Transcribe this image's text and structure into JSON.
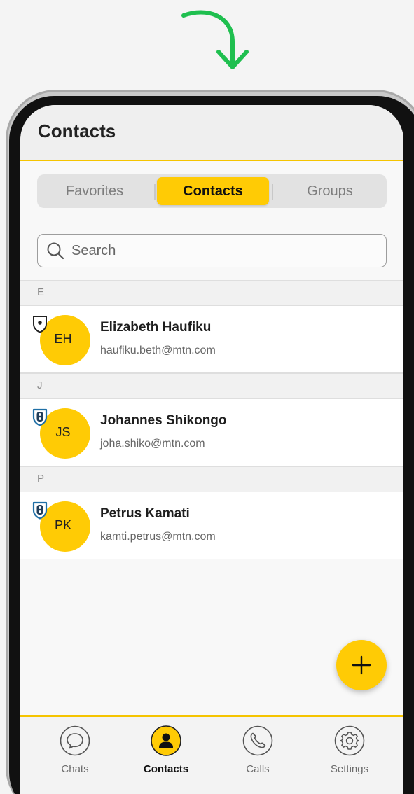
{
  "header": {
    "title": "Contacts"
  },
  "segmented": {
    "favorites": "Favorites",
    "contacts": "Contacts",
    "groups": "Groups",
    "selected": "Contacts"
  },
  "search": {
    "placeholder": "Search",
    "value": ""
  },
  "sections": [
    {
      "letter": "E",
      "contacts": [
        {
          "initials": "EH",
          "name": "Elizabeth Haufiku",
          "email": "haufiku.beth@mtn.com",
          "badge_icon": "shield-dot-icon"
        }
      ]
    },
    {
      "letter": "J",
      "contacts": [
        {
          "initials": "JS",
          "name": "Johannes Shikongo",
          "email": "joha.shiko@mtn.com",
          "badge_icon": "shield-blue-icon"
        }
      ]
    },
    {
      "letter": "P",
      "contacts": [
        {
          "initials": "PK",
          "name": "Petrus Kamati",
          "email": "kamti.petrus@mtn.com",
          "badge_icon": "shield-blue-icon"
        }
      ]
    }
  ],
  "fab": {
    "icon": "plus-icon"
  },
  "tabbar": {
    "items": [
      {
        "label": "Chats",
        "icon": "chat-bubble-icon",
        "active": false
      },
      {
        "label": "Contacts",
        "icon": "person-icon",
        "active": true
      },
      {
        "label": "Calls",
        "icon": "phone-icon",
        "active": false
      },
      {
        "label": "Settings",
        "icon": "gear-icon",
        "active": false
      }
    ]
  },
  "colors": {
    "accent": "#ffcb05",
    "arrow": "#1fbf4f",
    "shield_blue": "#1f6fa6"
  }
}
